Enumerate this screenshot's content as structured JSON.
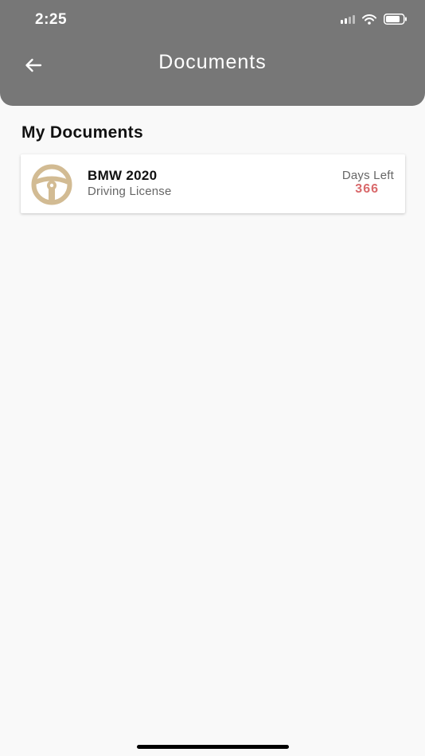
{
  "status_bar": {
    "time": "2:25"
  },
  "header": {
    "title": "Documents",
    "back_icon": "arrow-left-icon"
  },
  "section": {
    "title": "My Documents"
  },
  "documents": [
    {
      "icon": "steering-wheel-icon",
      "title": "BMW 2020",
      "subtitle": "Driving License",
      "days_left_label": "Days Left",
      "days_left_value": "366"
    }
  ],
  "colors": {
    "header_bg": "#777777",
    "page_bg": "#f9f9f9",
    "icon_gold": "#d2bb93",
    "days_value": "#d9696b"
  }
}
